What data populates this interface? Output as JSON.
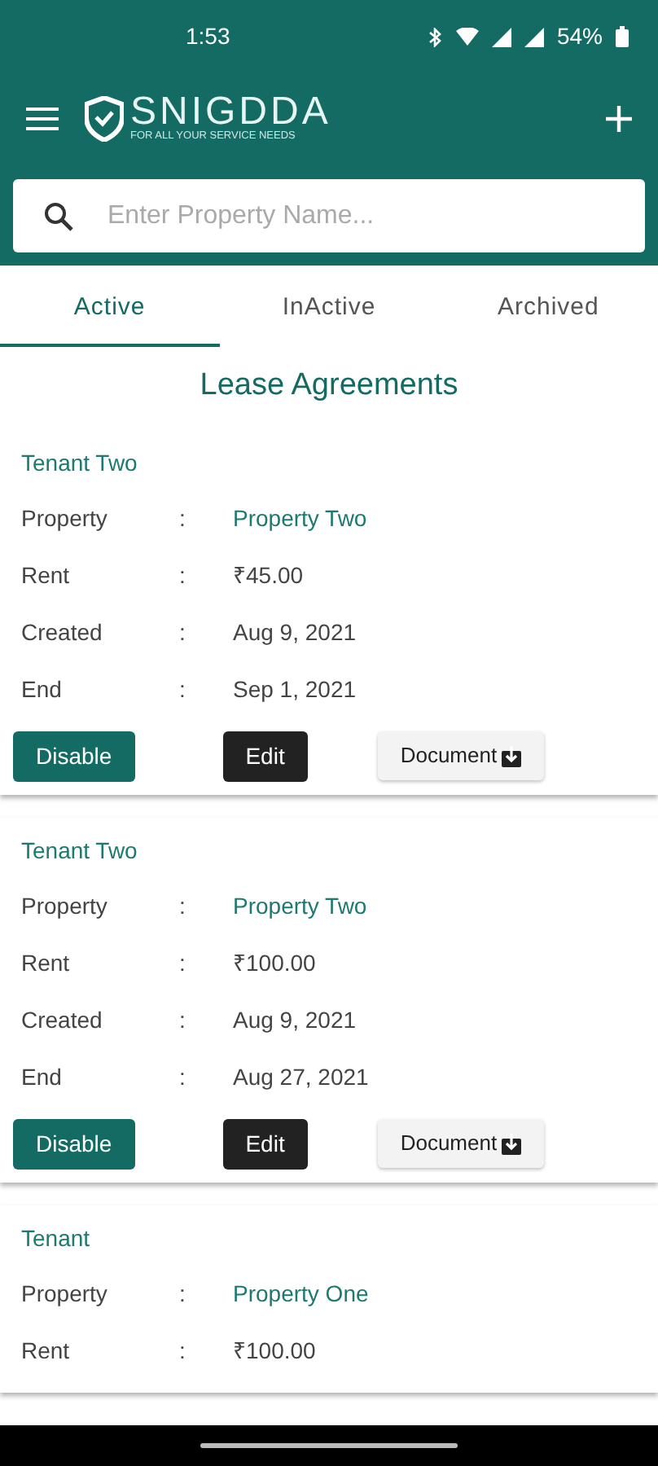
{
  "status_bar": {
    "time": "1:53",
    "battery": "54%"
  },
  "toolbar": {
    "logo_name": "SNIGDDA",
    "logo_tagline": "FOR ALL YOUR SERVICE NEEDS"
  },
  "search": {
    "placeholder": "Enter Property Name..."
  },
  "tabs": [
    {
      "label": "Active",
      "selected": true
    },
    {
      "label": "InActive",
      "selected": false
    },
    {
      "label": "Archived",
      "selected": false
    }
  ],
  "heading": "Lease Agreements",
  "agreements": [
    {
      "tenant": "Tenant Two",
      "fields": [
        {
          "label": "Property",
          "sep": ":",
          "value": "Property Two",
          "kind": "link"
        },
        {
          "label": "Rent",
          "sep": ":",
          "value": "₹45.00",
          "kind": "text"
        },
        {
          "label": "Created",
          "sep": ":",
          "value": "Aug 9, 2021",
          "kind": "text"
        },
        {
          "label": "End",
          "sep": ":",
          "value": "Sep 1, 2021",
          "kind": "text"
        }
      ],
      "buttons": [
        "Disable",
        "Edit",
        "Document"
      ]
    },
    {
      "tenant": "Tenant Two",
      "fields": [
        {
          "label": "Property",
          "sep": ":",
          "value": "Property Two",
          "kind": "link"
        },
        {
          "label": "Rent",
          "sep": ":",
          "value": "₹100.00",
          "kind": "text"
        },
        {
          "label": "Created",
          "sep": ":",
          "value": "Aug 9, 2021",
          "kind": "text"
        },
        {
          "label": "End",
          "sep": ":",
          "value": "Aug 27, 2021",
          "kind": "text"
        }
      ],
      "buttons": [
        "Disable",
        "Edit",
        "Document"
      ]
    },
    {
      "tenant": "Tenant",
      "fields": [
        {
          "label": "Property",
          "sep": ":",
          "value": "Property One",
          "kind": "link"
        },
        {
          "label": "Rent",
          "sep": ":",
          "value": "₹100.00",
          "kind": "text"
        }
      ]
    }
  ]
}
